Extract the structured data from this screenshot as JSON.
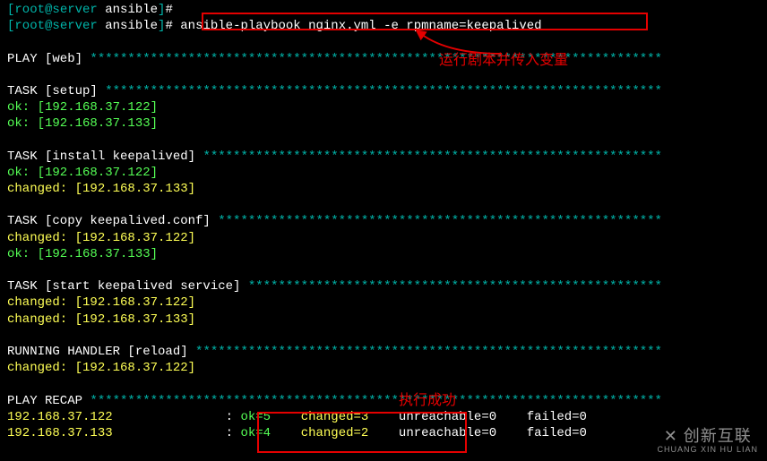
{
  "prompt_trunc": {
    "open": "[",
    "user_host": "root@server",
    "space": " ",
    "dir": "ansible",
    "close": "]",
    "hash": "#"
  },
  "cmd": " ansible-playbook nginx.yml -e rpmname=keepalived",
  "annotations": {
    "top_label": "运行剧本并传入变量",
    "success_label": "执行成功"
  },
  "watermark": {
    "main": "创新互联",
    "sub": "CHUANG XIN HU LIAN"
  },
  "play": {
    "header": "PLAY [web] ",
    "stars": "****************************************************************************"
  },
  "tasks": {
    "setup": {
      "header": "TASK [setup] ",
      "stars": "**************************************************************************",
      "r1": "ok: [192.168.37.122]",
      "r2": "ok: [192.168.37.133]"
    },
    "install": {
      "header": "TASK [install keepalived] ",
      "stars": "*************************************************************",
      "r1": "ok: [192.168.37.122]",
      "r2": "changed: [192.168.37.133]"
    },
    "copy": {
      "header": "TASK [copy keepalived.conf] ",
      "stars": "***********************************************************",
      "r1": "changed: [192.168.37.122]",
      "r2": "ok: [192.168.37.133]"
    },
    "start": {
      "header": "TASK [start keepalived service] ",
      "stars": "*******************************************************",
      "r1": "changed: [192.168.37.122]",
      "r2": "changed: [192.168.37.133]"
    },
    "handler": {
      "header": "RUNNING HANDLER [reload] ",
      "stars": "**************************************************************",
      "r1": "changed: [192.168.37.122]"
    }
  },
  "recap": {
    "header": "PLAY RECAP ",
    "stars": "****************************************************************************",
    "row1": {
      "host": "192.168.37.133",
      "pad": "               ",
      "colon": ": ",
      "ok": "ok=4",
      "gap1": "    ",
      "changed": "changed=2",
      "gap2": "    ",
      "unreachable": "unreachable=0",
      "gap3": "    ",
      "failed": "failed=0"
    },
    "row2": {
      "host": "192.168.37.122",
      "pad": "               ",
      "colon": ": ",
      "ok": "ok=5",
      "gap1": "    ",
      "changed": "changed=3",
      "gap2": "    ",
      "unreachable": "unreachable=0",
      "gap3": "    ",
      "failed": "failed=0"
    }
  }
}
